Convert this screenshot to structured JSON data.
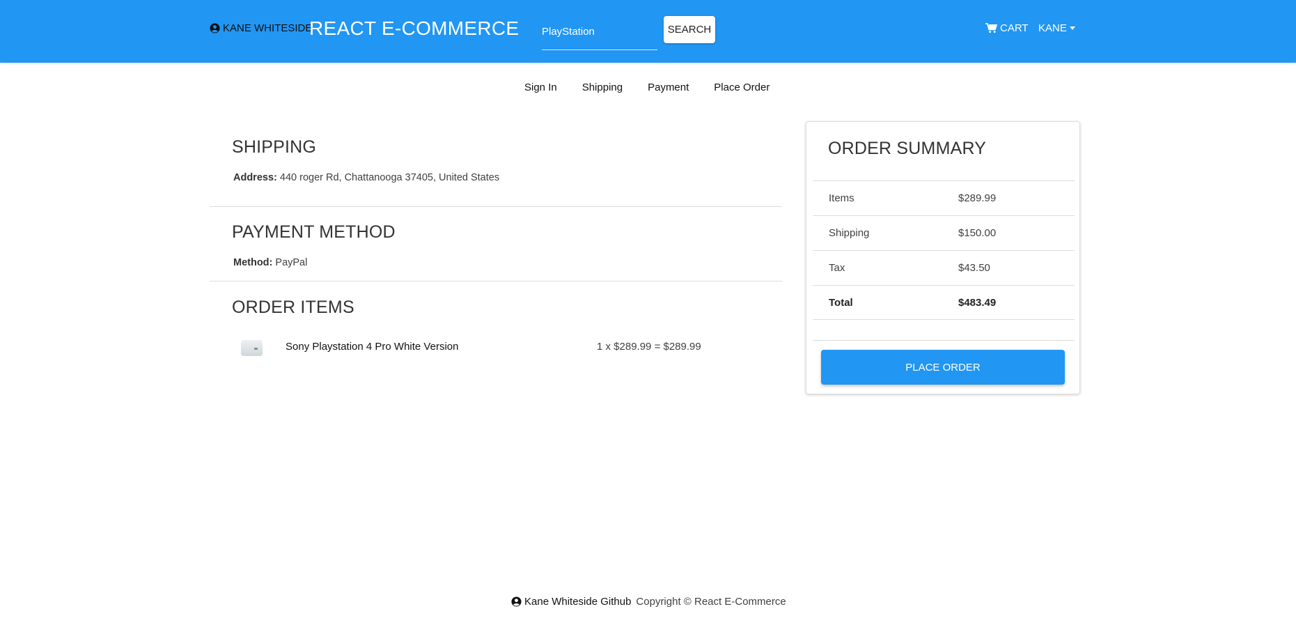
{
  "header": {
    "author": "KANE WHITESIDE",
    "brand": "REACT E-COMMERCE",
    "search_value": "PlayStation",
    "search_button": "SEARCH",
    "cart": "CART",
    "user": "KANE"
  },
  "steps": [
    "Sign In",
    "Shipping",
    "Payment",
    "Place Order"
  ],
  "shipping": {
    "title": "SHIPPING",
    "label": "Address:",
    "value": " 440 roger Rd, Chattanooga 37405, United States"
  },
  "payment": {
    "title": "PAYMENT METHOD",
    "label": "Method:",
    "value": " PayPal"
  },
  "order_items": {
    "title": "ORDER ITEMS",
    "items": [
      {
        "name": "Sony Playstation 4 Pro White Version",
        "calc": "1 x $289.99 = $289.99"
      }
    ]
  },
  "summary": {
    "title": "ORDER SUMMARY",
    "rows": [
      {
        "label": "Items",
        "value": "$289.99"
      },
      {
        "label": "Shipping",
        "value": "$150.00"
      },
      {
        "label": "Tax",
        "value": "$43.50"
      },
      {
        "label": "Total",
        "value": "$483.49"
      }
    ],
    "button": "PLACE ORDER"
  },
  "footer": {
    "link": "Kane Whiteside Github",
    "copyright": "Copyright © React E-Commerce"
  },
  "colors": {
    "primary": "#2196f3"
  }
}
